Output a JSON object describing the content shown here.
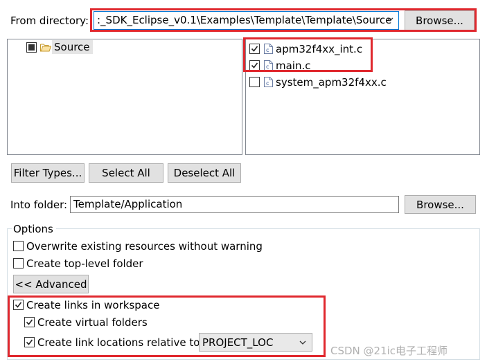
{
  "from_directory": {
    "label": "From directory:",
    "value": ":_SDK_Eclipse_v0.1\\Examples\\Template\\Template\\Source",
    "browse_label": "Browse..."
  },
  "tree": {
    "items": [
      {
        "label": "Source",
        "state": "partial"
      }
    ]
  },
  "files": {
    "items": [
      {
        "label": "apm32f4xx_int.c",
        "checked": true
      },
      {
        "label": "main.c",
        "checked": true
      },
      {
        "label": "system_apm32f4xx.c",
        "checked": false
      }
    ]
  },
  "buttons": {
    "filter_types": "Filter Types...",
    "select_all": "Select All",
    "deselect_all": "Deselect All"
  },
  "into_folder": {
    "label": "Into folder:",
    "value": "Template/Application",
    "browse_label": "Browse..."
  },
  "options": {
    "title": "Options",
    "overwrite_label": "Overwrite existing resources without warning",
    "overwrite_checked": false,
    "top_level_label": "Create top-level folder",
    "top_level_checked": false,
    "advanced_label": "<< Advanced",
    "create_links_label": "Create links in workspace",
    "create_links_checked": true,
    "virtual_folders_label": "Create virtual folders",
    "virtual_folders_checked": true,
    "relative_label": "Create link locations relative to:",
    "relative_checked": true,
    "relative_value": "PROJECT_LOC"
  },
  "watermark": "CSDN @21ic电子工程师",
  "colors": {
    "annotation_red": "#e0282e",
    "focus_blue": "#0078d7",
    "tree_selection": "#e5e5e5",
    "folder_yellow": "#e8b84a"
  }
}
